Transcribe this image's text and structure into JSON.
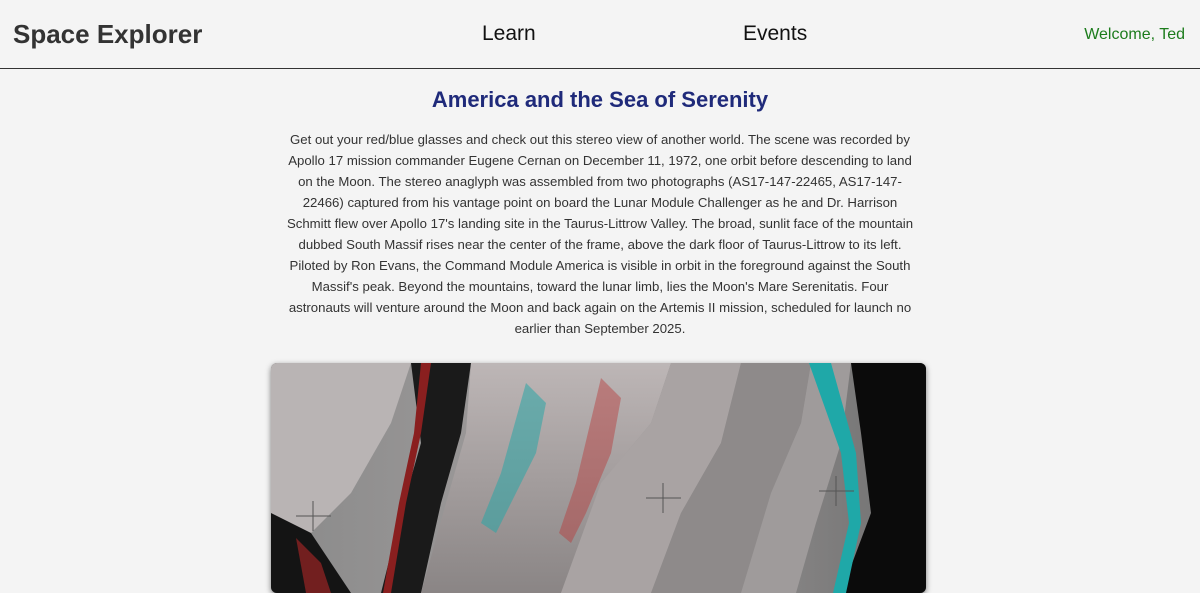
{
  "navbar": {
    "brand": "Space Explorer",
    "links": [
      "Learn",
      "Events"
    ],
    "welcome": "Welcome, Ted"
  },
  "article": {
    "title": "America and the Sea of Serenity",
    "description": "Get out your red/blue glasses and check out this stereo view of another world. The scene was recorded by Apollo 17 mission commander Eugene Cernan on December 11, 1972, one orbit before descending to land on the Moon. The stereo anaglyph was assembled from two photographs (AS17-147-22465, AS17-147-22466) captured from his vantage point on board the Lunar Module Challenger as he and Dr. Harrison Schmitt flew over Apollo 17's landing site in the Taurus-Littrow Valley. The broad, sunlit face of the mountain dubbed South Massif rises near the center of the frame, above the dark floor of Taurus-Littrow to its left. Piloted by Ron Evans, the Command Module America is visible in orbit in the foreground against the South Massif's peak. Beyond the mountains, toward the lunar limb, lies the Moon's Mare Serenitatis. Four astronauts will venture around the Moon and back again on the Artemis II mission, scheduled for launch no earlier than September 2025."
  },
  "colors": {
    "background": "#f4f4f4",
    "title": "#1f2a7a",
    "welcome": "#1c7c1c"
  }
}
